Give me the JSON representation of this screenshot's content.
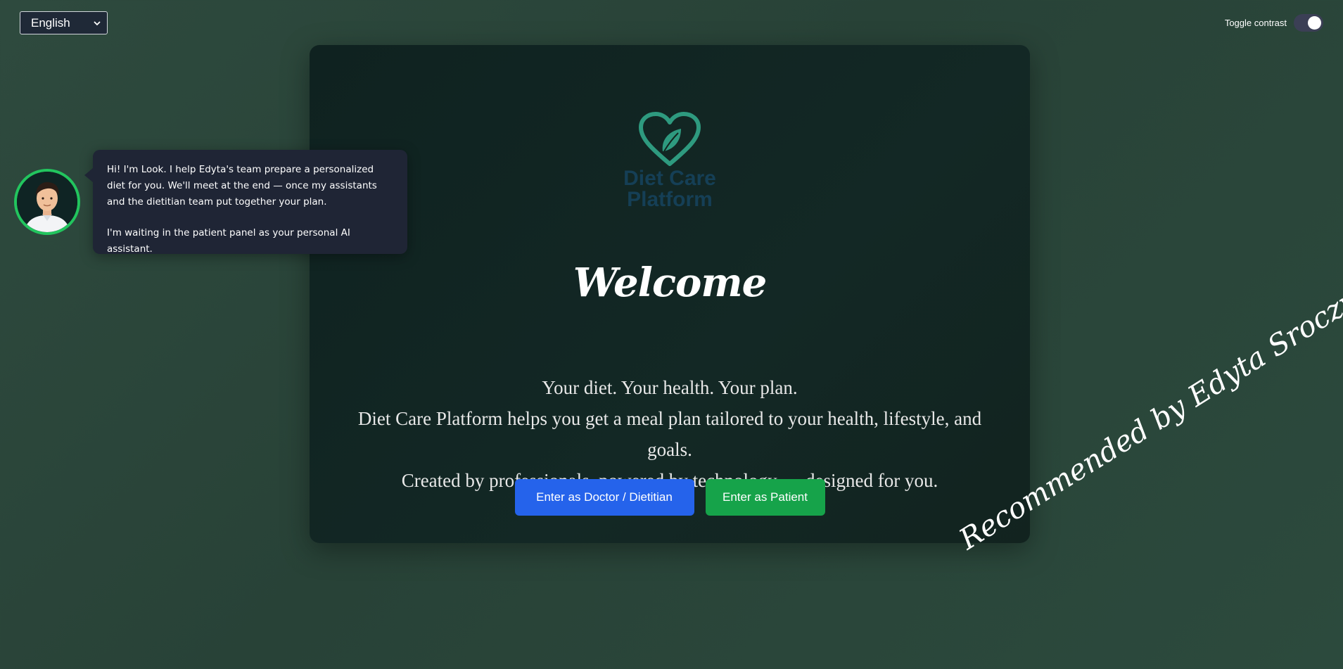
{
  "language_select": {
    "value": "English"
  },
  "contrast": {
    "label": "Toggle contrast",
    "enabled": true
  },
  "logo": {
    "line1": "Diet Care",
    "line2": "Platform"
  },
  "main": {
    "title": "Welcome",
    "tagline": [
      "Your diet. Your health. Your plan.",
      "Diet Care Platform helps you get a meal plan tailored to your health, lifestyle, and goals.",
      "Created by professionals, powered by technology — designed for you."
    ],
    "buttons": {
      "doctor": "Enter as Doctor / Dietitian",
      "patient": "Enter as Patient"
    }
  },
  "assistant": {
    "message_1": "Hi! I'm Look. I help Edyta's team prepare a personalized diet for you. We'll meet at the end — once my assistants and the dietitian team put together your plan.",
    "message_2": "I'm waiting in the patient panel as your personal AI assistant."
  },
  "recommended": "Recommended by Edyta Sroczyńska",
  "colors": {
    "background": "#2c473c",
    "card": "#12251f",
    "doctor_button": "#2563eb",
    "patient_button": "#16a34a",
    "logo_green": "#2e9a7f",
    "logo_text": "#153f56",
    "avatar_border": "#22c55e"
  }
}
